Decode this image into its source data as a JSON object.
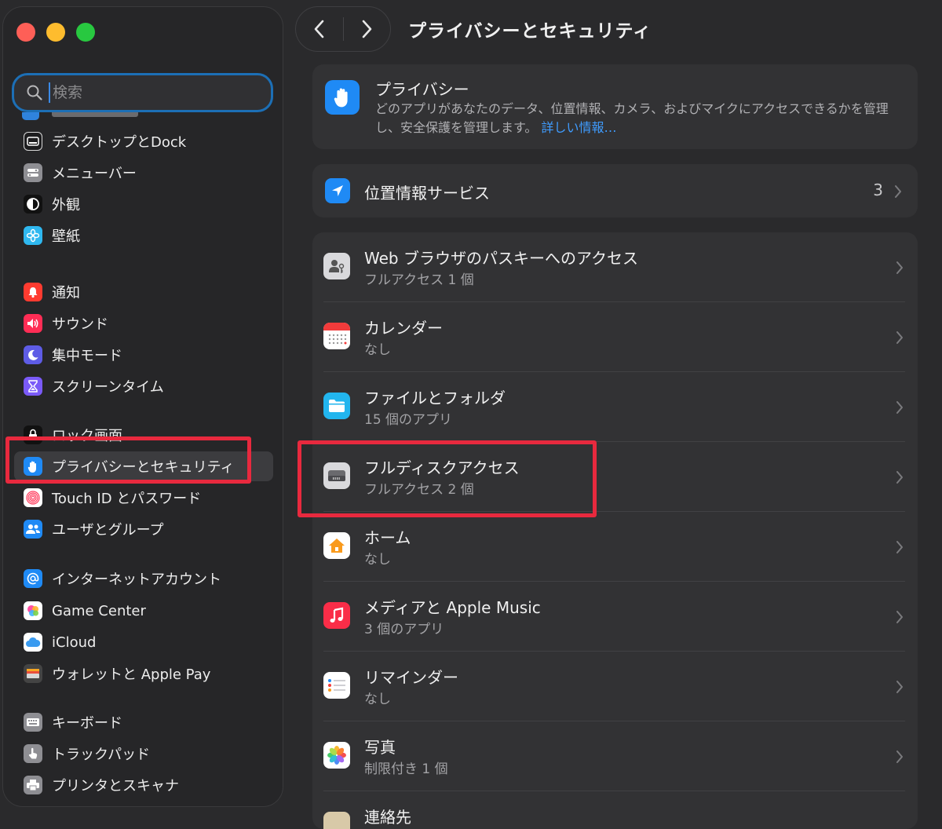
{
  "window": {
    "title": "プライバシーとセキュリティ"
  },
  "search": {
    "placeholder": "検索"
  },
  "sidebar": {
    "items": [
      {
        "label": "デスクトップとDock",
        "icon": "dock-icon",
        "color": "#ffffff"
      },
      {
        "label": "メニューバー",
        "icon": "menubar-icon",
        "color": "#8e8e93"
      },
      {
        "label": "外観",
        "icon": "appearance-icon",
        "color": "#111111"
      },
      {
        "label": "壁紙",
        "icon": "wallpaper-icon",
        "color": "#2fb8f0"
      },
      {
        "label": "通知",
        "icon": "notification-icon",
        "color": "#ff3b30"
      },
      {
        "label": "サウンド",
        "icon": "sound-icon",
        "color": "#ff2d55"
      },
      {
        "label": "集中モード",
        "icon": "focus-moon-icon",
        "color": "#5e5ce6"
      },
      {
        "label": "スクリーンタイム",
        "icon": "hourglass-icon",
        "color": "#7a5af8"
      },
      {
        "label": "ロック画面",
        "icon": "lock-icon",
        "color": "#111111"
      },
      {
        "label": "プライバシーとセキュリティ",
        "icon": "hand-icon",
        "color": "#1f8af5"
      },
      {
        "label": "Touch ID とパスワード",
        "icon": "fingerprint-icon",
        "color": "#ffffff"
      },
      {
        "label": "ユーザとグループ",
        "icon": "users-icon",
        "color": "#1f8af5"
      },
      {
        "label": "インターネットアカウント",
        "icon": "at-icon",
        "color": "#1f8af5"
      },
      {
        "label": "Game Center",
        "icon": "game-center-icon",
        "color": "#ffffff"
      },
      {
        "label": "iCloud",
        "icon": "cloud-icon",
        "color": "#ffffff"
      },
      {
        "label": "ウォレットと Apple Pay",
        "icon": "wallet-icon",
        "color": "#444444"
      },
      {
        "label": "キーボード",
        "icon": "keyboard-icon",
        "color": "#8e8e93"
      },
      {
        "label": "トラックパッド",
        "icon": "trackpad-icon",
        "color": "#8e8e93"
      },
      {
        "label": "プリンタとスキャナ",
        "icon": "printer-icon",
        "color": "#8e8e93"
      }
    ]
  },
  "header": {
    "title": "プライバシー",
    "description": "どのアプリがあなたのデータ、位置情報、カメラ、およびマイクにアクセスできるかを管理し、安全保護を管理します。",
    "link": "詳しい情報…"
  },
  "location": {
    "label": "位置情報サービス",
    "count": "3"
  },
  "list": [
    {
      "title": "Web ブラウザのパスキーへのアクセス",
      "subtitle": "フルアクセス 1 個",
      "icon": "passkey-person-icon"
    },
    {
      "title": "カレンダー",
      "subtitle": "なし",
      "icon": "calendar-icon"
    },
    {
      "title": "ファイルとフォルダ",
      "subtitle": "15 個のアプリ",
      "icon": "folder-icon"
    },
    {
      "title": "フルディスクアクセス",
      "subtitle": "フルアクセス 2 個",
      "icon": "disk-icon"
    },
    {
      "title": "ホーム",
      "subtitle": "なし",
      "icon": "home-icon"
    },
    {
      "title": "メディアと Apple Music",
      "subtitle": "3 個のアプリ",
      "icon": "music-icon"
    },
    {
      "title": "リマインダー",
      "subtitle": "なし",
      "icon": "reminders-icon"
    },
    {
      "title": "写真",
      "subtitle": "制限付き 1 個",
      "icon": "photos-icon"
    },
    {
      "title": "連絡先",
      "subtitle": "",
      "icon": "contacts-icon"
    }
  ],
  "colors": {
    "highlight": "#e8293e",
    "accent": "#1f8af5",
    "link": "#3f9cff"
  }
}
